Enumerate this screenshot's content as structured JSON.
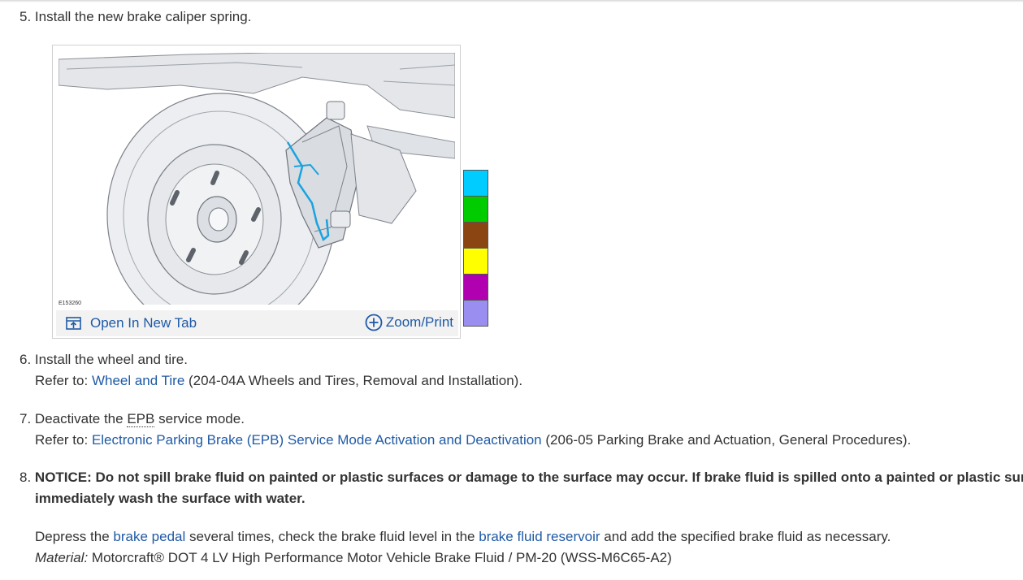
{
  "steps": {
    "s5": {
      "number": "5.",
      "text": "Install the new brake caliper spring."
    },
    "figure": {
      "id": "E153260",
      "open_tab_label": "Open In New Tab",
      "zoom_label": "Zoom/Print"
    },
    "swatches": [
      "#00ccff",
      "#00cc00",
      "#8b4513",
      "#ffff00",
      "#b000b0",
      "#9a8ff0"
    ],
    "s6": {
      "number": "6.",
      "text": "Install the wheel and tire.",
      "refer": "Refer to:",
      "link": "Wheel and Tire",
      "ref_tail": "(204-04A Wheels and Tires, Removal and Installation)."
    },
    "s7": {
      "number": "7.",
      "text_a": "Deactivate the",
      "abbr": "EPB",
      "text_b": "service mode.",
      "refer": "Refer to:",
      "link": "Electronic Parking Brake (EPB) Service Mode Activation and Deactivation",
      "ref_tail": "(206-05 Parking Brake and Actuation, General Procedures)."
    },
    "s8": {
      "number": "8.",
      "notice_line1": "NOTICE: Do not spill brake fluid on painted or plastic surfaces or damage to the surface may occur. If brake fluid is spilled onto a painted or plastic surface,",
      "notice_line2": "immediately wash the surface with water.",
      "p_a": "Depress the",
      "link_pedal": "brake pedal",
      "p_b": "several times, check the brake fluid level in the",
      "link_reservoir": "brake fluid reservoir",
      "p_c": "and add the specified brake fluid as necessary.",
      "material_label": "Material:",
      "material_text": "Motorcraft® DOT 4 LV High Performance Motor Vehicle Brake Fluid / PM-20 (WSS-M6C65-A2)"
    }
  }
}
